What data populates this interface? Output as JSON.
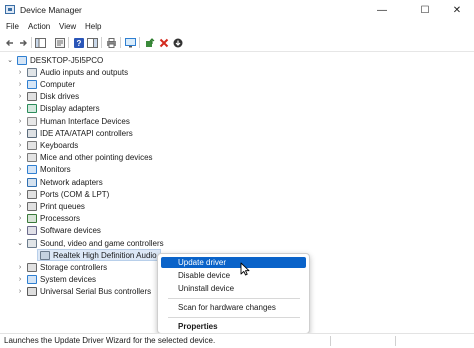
{
  "window": {
    "title": "Device Manager",
    "minimize_glyph": "—",
    "maximize_glyph": "☐",
    "close_glyph": "✕"
  },
  "menu": [
    "File",
    "Action",
    "View",
    "Help"
  ],
  "toolbar": {
    "icons": [
      "back-arrow-icon",
      "forward-arrow-icon",
      "show-hide-console-tree-icon",
      "properties-icon",
      "help-icon",
      "action-pane-icon",
      "print-icon",
      "monitor-icon",
      "update-driver-icon",
      "uninstall-icon",
      "enable-device-icon"
    ]
  },
  "tree": {
    "root": "DESKTOP-J5I5PCO",
    "categories": [
      {
        "label": "Audio inputs and outputs",
        "icon": "speaker-icon",
        "color": "#6b7b8c",
        "expanded": false
      },
      {
        "label": "Computer",
        "icon": "computer-icon",
        "color": "#2f7fd1",
        "expanded": false
      },
      {
        "label": "Disk drives",
        "icon": "disk-drive-icon",
        "color": "#6a6a6a",
        "expanded": false
      },
      {
        "label": "Display adapters",
        "icon": "display-adapter-icon",
        "color": "#2a8c5a",
        "expanded": false
      },
      {
        "label": "Human Interface Devices",
        "icon": "hid-icon",
        "color": "#8a8a8a",
        "expanded": false
      },
      {
        "label": "IDE ATA/ATAPI controllers",
        "icon": "ide-controller-icon",
        "color": "#5a6a7a",
        "expanded": false
      },
      {
        "label": "Keyboards",
        "icon": "keyboard-icon",
        "color": "#7a7a7a",
        "expanded": false
      },
      {
        "label": "Mice and other pointing devices",
        "icon": "mouse-icon",
        "color": "#7a7a7a",
        "expanded": false
      },
      {
        "label": "Monitors",
        "icon": "monitor-icon",
        "color": "#2f7fd1",
        "expanded": false
      },
      {
        "label": "Network adapters",
        "icon": "network-adapter-icon",
        "color": "#2f6fb1",
        "expanded": false
      },
      {
        "label": "Ports (COM & LPT)",
        "icon": "port-icon",
        "color": "#6a6a6a",
        "expanded": false
      },
      {
        "label": "Print queues",
        "icon": "printer-icon",
        "color": "#6a6a6a",
        "expanded": false
      },
      {
        "label": "Processors",
        "icon": "processor-icon",
        "color": "#3a7a3a",
        "expanded": false
      },
      {
        "label": "Software devices",
        "icon": "software-device-icon",
        "color": "#6a6a8a",
        "expanded": false
      },
      {
        "label": "Sound, video and game controllers",
        "icon": "sound-icon",
        "color": "#6b7b8c",
        "expanded": true
      },
      {
        "label": "Storage controllers",
        "icon": "storage-controller-icon",
        "color": "#6a6a6a",
        "expanded": false
      },
      {
        "label": "System devices",
        "icon": "system-device-icon",
        "color": "#2f7fd1",
        "expanded": false
      },
      {
        "label": "Universal Serial Bus controllers",
        "icon": "usb-icon",
        "color": "#5a5a5a",
        "expanded": false
      }
    ],
    "selected_child": {
      "label": "Realtek High Definition Audio",
      "icon": "speaker-icon",
      "parent": "Sound, video and game controllers"
    }
  },
  "context_menu": {
    "items": [
      {
        "label": "Update driver",
        "highlighted": true
      },
      {
        "label": "Disable device"
      },
      {
        "label": "Uninstall device"
      },
      {
        "separator": true
      },
      {
        "label": "Scan for hardware changes"
      },
      {
        "separator": true
      },
      {
        "label": "Properties",
        "bold": true
      }
    ]
  },
  "status_bar": {
    "text": "Launches the Update Driver Wizard for the selected device."
  },
  "colors": {
    "accent": "#0a63c9",
    "selection_bg": "#dde8f6"
  }
}
